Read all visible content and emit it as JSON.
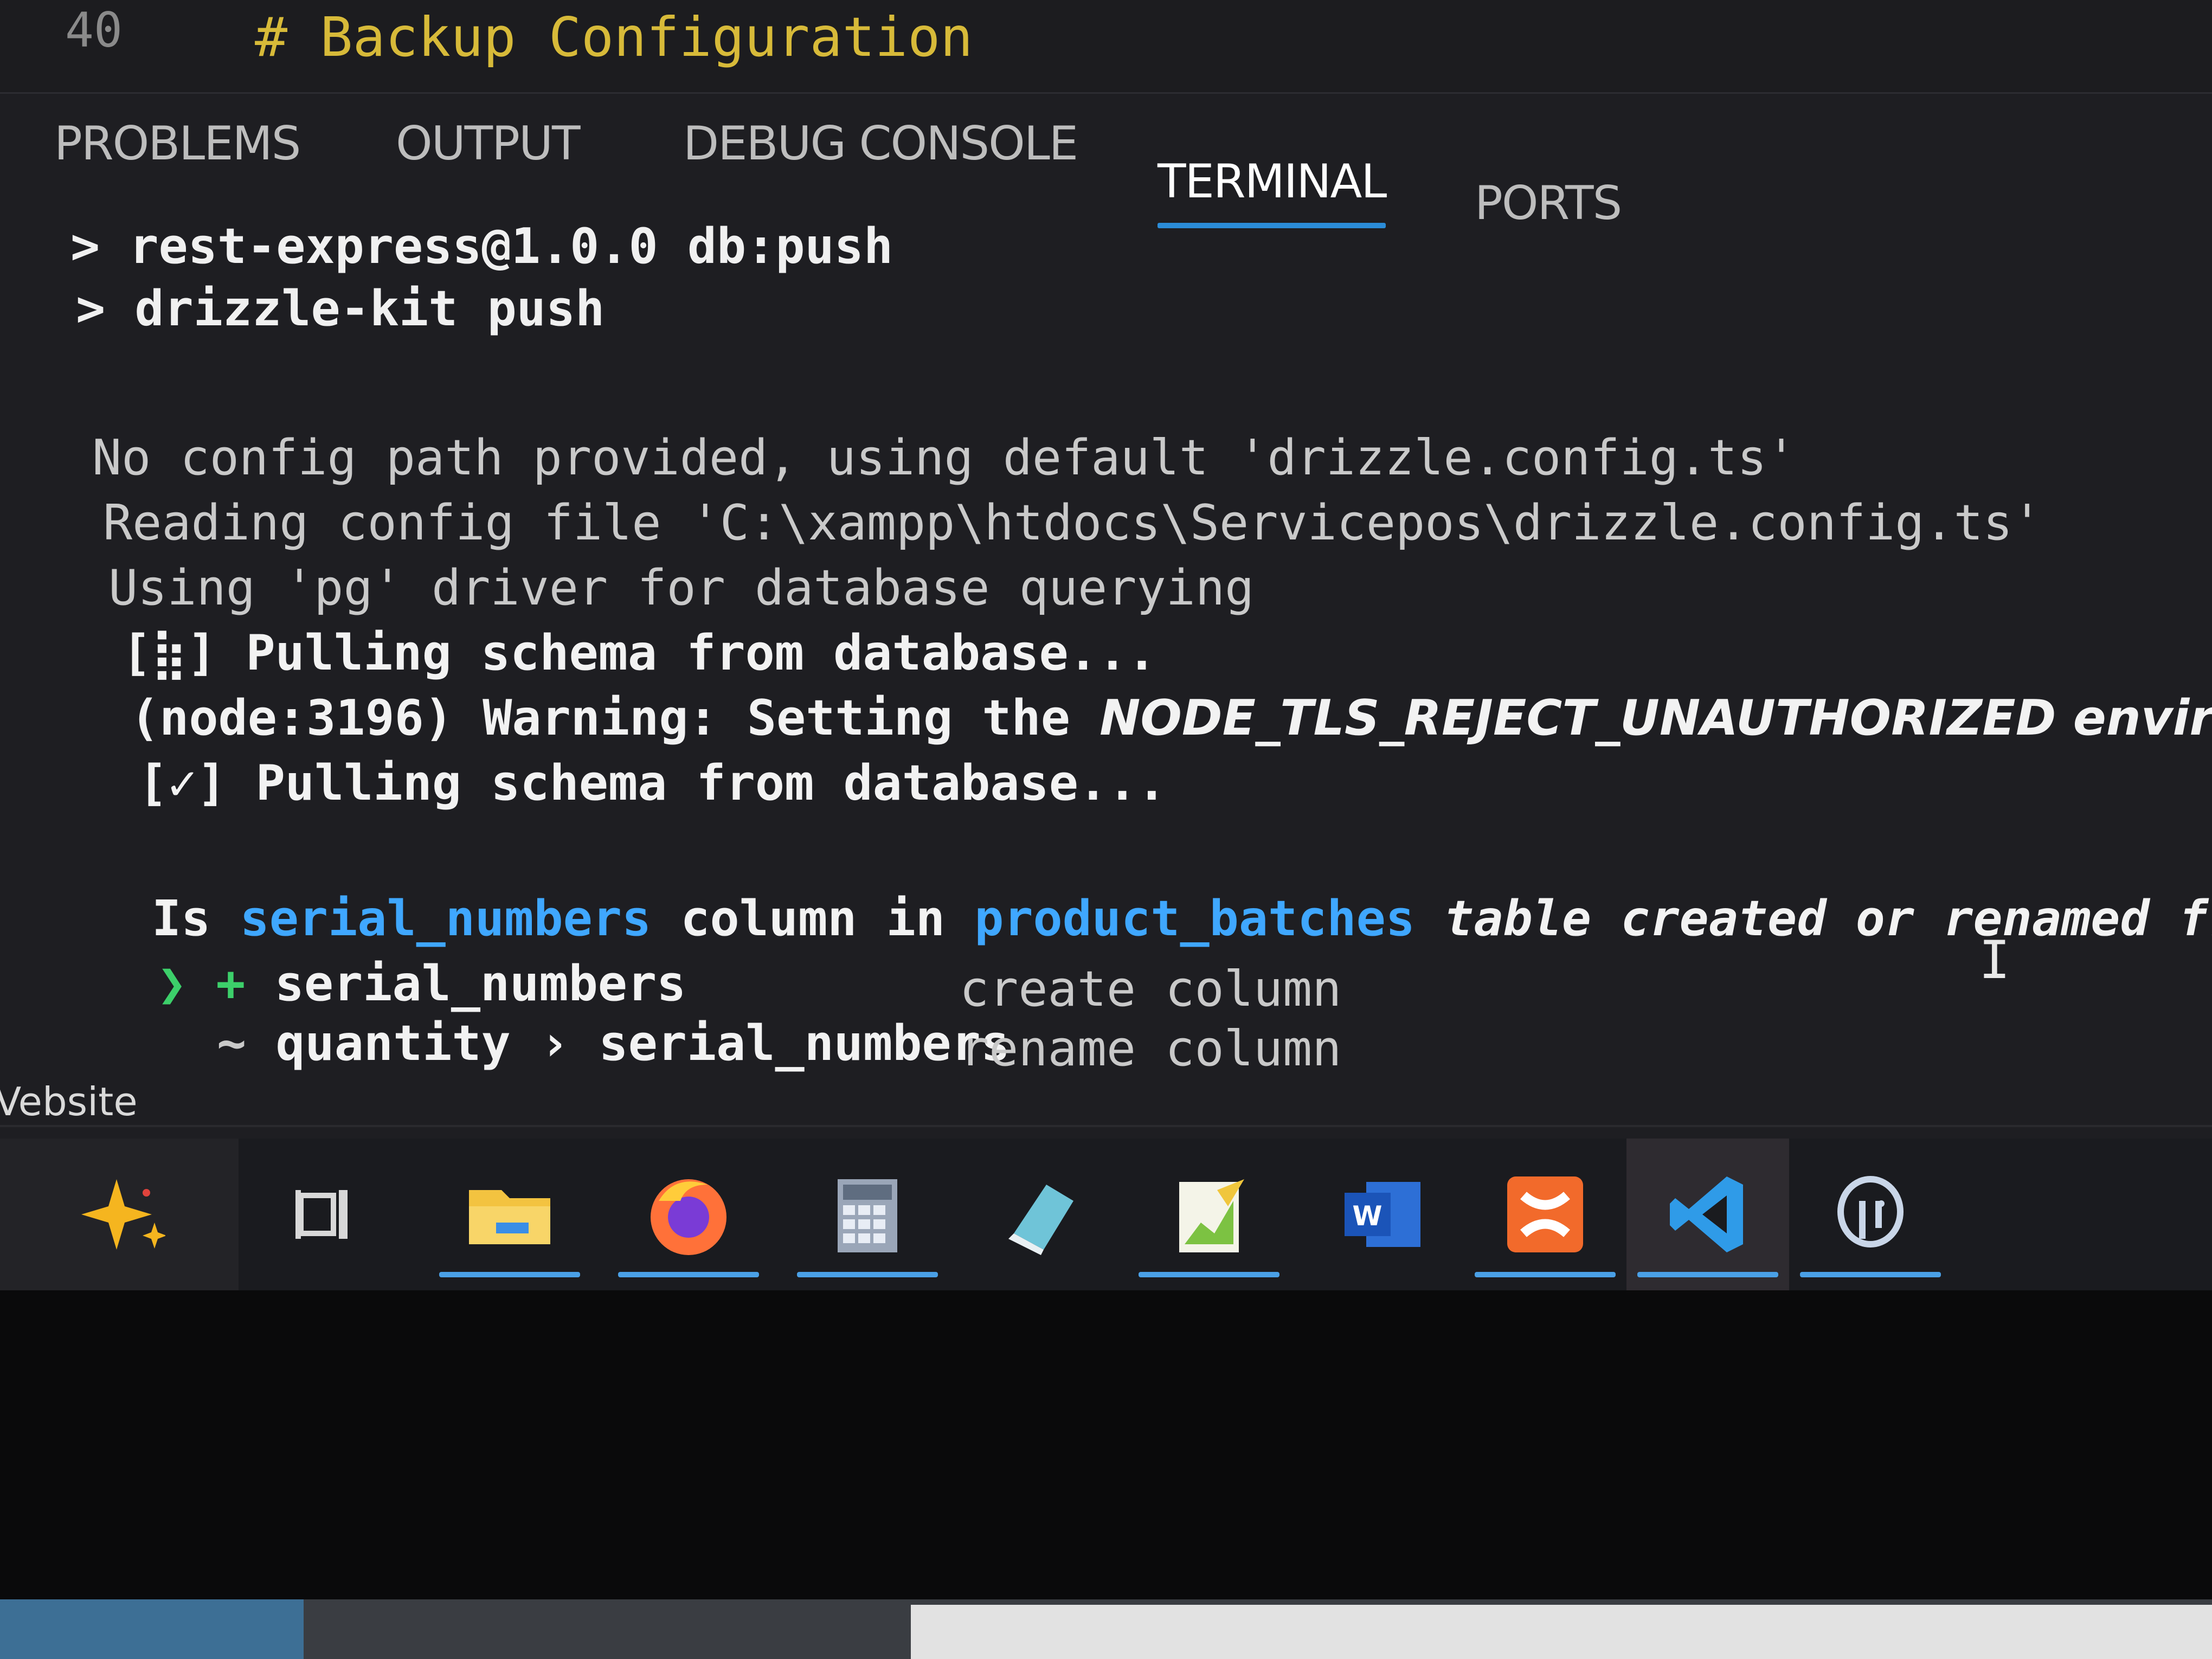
{
  "editor": {
    "line_number": "40",
    "comment": "# Backup Configuration"
  },
  "panel": {
    "tabs": [
      {
        "label": "PROBLEMS",
        "active": false
      },
      {
        "label": "OUTPUT",
        "active": false
      },
      {
        "label": "DEBUG CONSOLE",
        "active": false
      },
      {
        "label": "TERMINAL",
        "active": true
      },
      {
        "label": "PORTS",
        "active": false
      }
    ]
  },
  "terminal": {
    "cmd1": "> rest-express@1.0.0 db:push",
    "cmd2": "> drizzle-kit push",
    "out1": "No config path provided, using default 'drizzle.config.ts'",
    "out2": "Reading config file 'C:\\xampp\\htdocs\\Servicepos\\drizzle.config.ts'",
    "out3": "Using 'pg' driver for database querying",
    "pull1_icon": "[⣷]",
    "pull1_text": " Pulling schema from database...",
    "warn_prefix": "(node:3196) Warning: Setting the ",
    "warn_rest": "NODE_TLS_REJECT_UNAUTHORIZED environment varia",
    "pull2_icon": "[✓]",
    "pull2_text": " Pulling schema from database...",
    "q_is": "Is ",
    "q_column": "serial_numbers",
    "q_mid": " column in ",
    "q_table": "product_batches",
    "q_end": " table created or renamed from another",
    "opt1_marker": "❯ +",
    "opt1_name": " serial_numbers",
    "opt1_action": "create column",
    "opt2_marker": "~",
    "opt2_name": " quantity › serial_numbers",
    "opt2_action": "rename column"
  },
  "status_label": "Vebsite",
  "taskbar": {
    "apps": [
      {
        "name": "copilot",
        "icon": "sparkle-icon",
        "running": false
      },
      {
        "name": "task-view",
        "icon": "task-view-icon",
        "running": false
      },
      {
        "name": "file-explorer",
        "icon": "folder-icon",
        "running": true
      },
      {
        "name": "firefox",
        "icon": "firefox-icon",
        "running": true
      },
      {
        "name": "calculator",
        "icon": "calculator-icon",
        "running": true
      },
      {
        "name": "notepad",
        "icon": "notepad-icon",
        "running": false
      },
      {
        "name": "notepad-plus-plus",
        "icon": "notepadpp-icon",
        "running": true
      },
      {
        "name": "word",
        "icon": "word-icon",
        "running": false
      },
      {
        "name": "xampp",
        "icon": "xampp-icon",
        "running": true
      },
      {
        "name": "vscode",
        "icon": "vscode-icon",
        "running": true,
        "active": true
      },
      {
        "name": "pgadmin",
        "icon": "postgres-icon",
        "running": true
      }
    ],
    "word_letter": "W"
  },
  "colors": {
    "accent": "#2b8cd8",
    "highlight": "#3fa7ff",
    "comment": "#d7ba39",
    "prompt_green": "#3ccf6a"
  }
}
